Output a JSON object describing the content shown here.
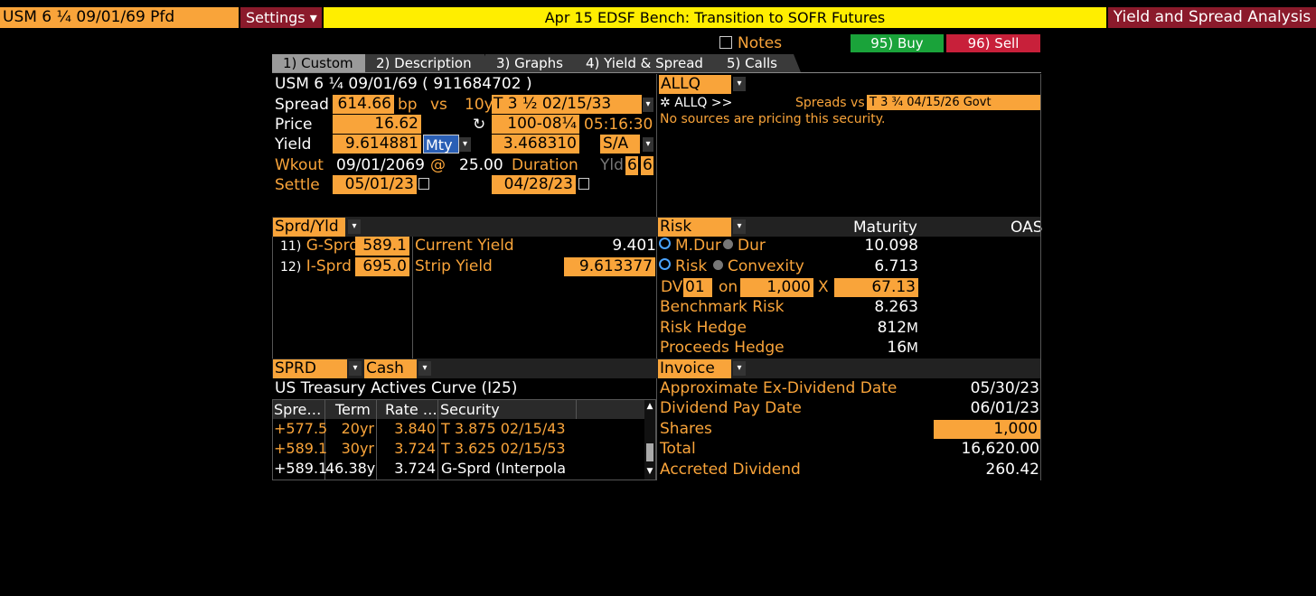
{
  "topbar": {
    "security": "USM 6 ¼ 09/01/69 Pfd",
    "settings": "Settings ▾",
    "news": "Apr 15 EDSF Bench: Transition to SOFR Futures",
    "title": "Yield and Spread Analysis"
  },
  "actions": {
    "notes": "Notes",
    "buy": "95) Buy",
    "sell": "96) Sell"
  },
  "tabs": [
    {
      "label": "1) Custom"
    },
    {
      "label": "2) Description"
    },
    {
      "label": "3) Graphs"
    },
    {
      "label": "4) Yield & Spread"
    },
    {
      "label": "5) Calls"
    }
  ],
  "security": {
    "header": "USM 6 ¼ 09/01/69 ( 911684702 )",
    "spread_label": "Spread",
    "spread": "614.66",
    "spread_unit": "bp",
    "vs": "vs",
    "bench_term": "10y",
    "bench": "T 3 ½ 02/15/33",
    "price_label": "Price",
    "price": "16.62",
    "bench_price": "100-08¼",
    "time": "05:16:30",
    "yield_label": "Yield",
    "yield": "9.614881",
    "yield_type": "Mty",
    "bench_yield": "3.468310",
    "freq": "S/A",
    "wkout_label": "Wkout",
    "wkout_date": "09/01/2069",
    "at": "@",
    "wkout_price": "25.00",
    "duration_label": "Duration",
    "yld_label": "Yld",
    "yld_a": "6",
    "yld_b": "6",
    "settle_label": "Settle",
    "settle": "05/01/23",
    "bench_settle": "04/28/23"
  },
  "source": {
    "selector": "ALLQ",
    "allq": "ALLQ >>",
    "spreads_vs_label": "Spreads vs",
    "spreads_vs": "T 3 ¾ 04/15/26 Govt",
    "message": "No sources are pricing this security."
  },
  "sprd_yld": {
    "selector": "Sprd/Yld",
    "rows": [
      {
        "num": "11)",
        "label": "G-Sprd",
        "value": "589.1",
        "metric": "Current Yield",
        "metric_value": "9.401"
      },
      {
        "num": "12)",
        "label": "I-Sprd",
        "value": "695.0",
        "metric": "Strip Yield",
        "metric_value": "9.613377"
      }
    ]
  },
  "risk": {
    "selector": "Risk",
    "col_maturity": "Maturity",
    "col_oas": "OAS",
    "mdur": "M.Dur",
    "dur": "Dur",
    "mdur_value": "10.098",
    "risk": "Risk",
    "convexity": "Convexity",
    "risk_value": "6.713",
    "dv_label": "DV",
    "dv_num": "01",
    "on": "on",
    "dv_amount": "1,000",
    "x": "X",
    "dv_result": "67.13",
    "bench_risk_label": "Benchmark Risk",
    "bench_risk": "8.263",
    "risk_hedge_label": "Risk Hedge",
    "risk_hedge": "812",
    "risk_hedge_unit": "M",
    "proceeds_label": "Proceeds Hedge",
    "proceeds": "16",
    "proceeds_unit": "M"
  },
  "curve": {
    "sel1": "SPRD",
    "sel2": "Cash",
    "title": "US Treasury Actives Curve (I25)",
    "columns": [
      "Spre…",
      "Term",
      "Rate …",
      "Security"
    ],
    "rows": [
      {
        "spread": "+577.5",
        "term": "20yr",
        "rate": "3.840",
        "security": "T 3.875 02/15/43"
      },
      {
        "spread": "+589.1",
        "term": "30yr",
        "rate": "3.724",
        "security": "T 3.625 02/15/53"
      },
      {
        "spread": "+589.1",
        "term": "46.38y",
        "rate": "3.724",
        "security": "G-Sprd (Interpola"
      }
    ]
  },
  "invoice": {
    "selector": "Invoice",
    "exdiv_label": "Approximate Ex-Dividend Date",
    "exdiv": "05/30/23",
    "pay_label": "Dividend Pay Date",
    "pay": "06/01/23",
    "shares_label": "Shares",
    "shares": "1,000",
    "total_label": "Total",
    "total": "16,620.00",
    "accrued_label": "Accreted Dividend",
    "accrued": "260.42"
  },
  "colors": {
    "orange": "#f9a43a",
    "yellow": "#ffee00",
    "maroon": "#8b1a2b",
    "buy": "#1aa33a",
    "sell": "#c8203a"
  }
}
